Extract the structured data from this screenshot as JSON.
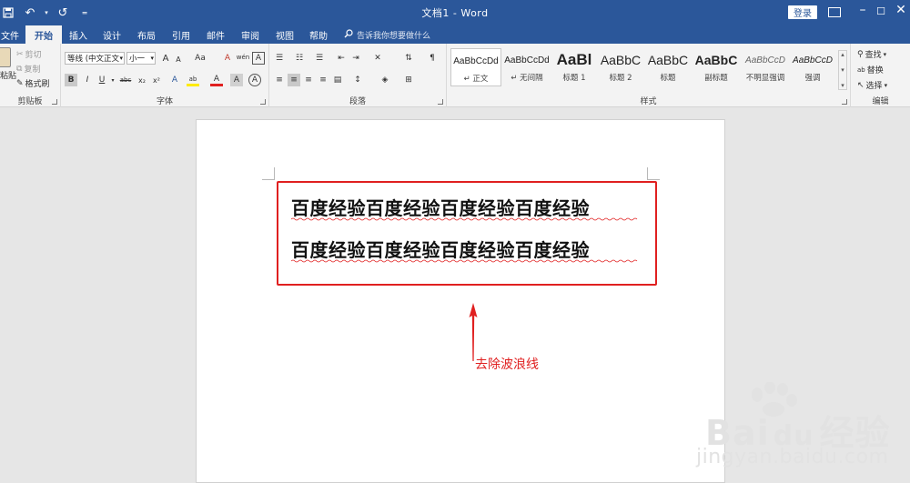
{
  "window": {
    "title": "文档1 - Word",
    "login": "登录"
  },
  "tabs": [
    "文件",
    "开始",
    "插入",
    "设计",
    "布局",
    "引用",
    "邮件",
    "审阅",
    "视图",
    "帮助"
  ],
  "active_tab": "开始",
  "tellme": "告诉我你想要做什么",
  "clipboard": {
    "paste": "粘贴",
    "cut": "剪切",
    "copy": "复制",
    "format_painter": "格式刷",
    "label": "剪贴板"
  },
  "font": {
    "name": "等线 (中文正文",
    "size": "小一",
    "grow": "A",
    "shrink": "A",
    "change_case": "Aa",
    "clear": "A",
    "phonetic": "wén",
    "border_char": "A",
    "bold": "B",
    "italic": "I",
    "underline": "U",
    "strike": "abc",
    "sub": "x₂",
    "sup": "x²",
    "effects": "A",
    "highlight": "ab",
    "font_color": "A",
    "shading": "A",
    "enclose": "A",
    "label": "字体"
  },
  "paragraph": {
    "label": "段落"
  },
  "styles": {
    "label": "样式",
    "items": [
      {
        "preview": "AaBbCcDd",
        "name": "正文",
        "prefix": "↵"
      },
      {
        "preview": "AaBbCcDd",
        "name": "无间隔",
        "prefix": "↵"
      },
      {
        "preview": "AaBl",
        "name": "标题 1",
        "prefix": ""
      },
      {
        "preview": "AaBbC",
        "name": "标题 2",
        "prefix": ""
      },
      {
        "preview": "AaBbC",
        "name": "标题",
        "prefix": ""
      },
      {
        "preview": "AaBbC",
        "name": "副标题",
        "prefix": ""
      },
      {
        "preview": "AaBbCcD",
        "name": "不明显强调",
        "prefix": ""
      },
      {
        "preview": "AaBbCcD",
        "name": "强调",
        "prefix": ""
      }
    ]
  },
  "editing": {
    "find": "查找",
    "replace": "替换",
    "select": "选择",
    "label": "编辑"
  },
  "document": {
    "lines": [
      "百度经验百度经验百度经验百度经验",
      "百度经验百度经验百度经验百度经验"
    ]
  },
  "annotation": {
    "text": "去除波浪线",
    "color": "#e02020"
  },
  "watermark": {
    "brand": "Bai",
    "brand_cn": "经验",
    "url": "jingyan.baidu.com"
  },
  "colors": {
    "accent": "#2b579a",
    "ribbon": "#f3f3f3",
    "highlight": "#e02020"
  }
}
